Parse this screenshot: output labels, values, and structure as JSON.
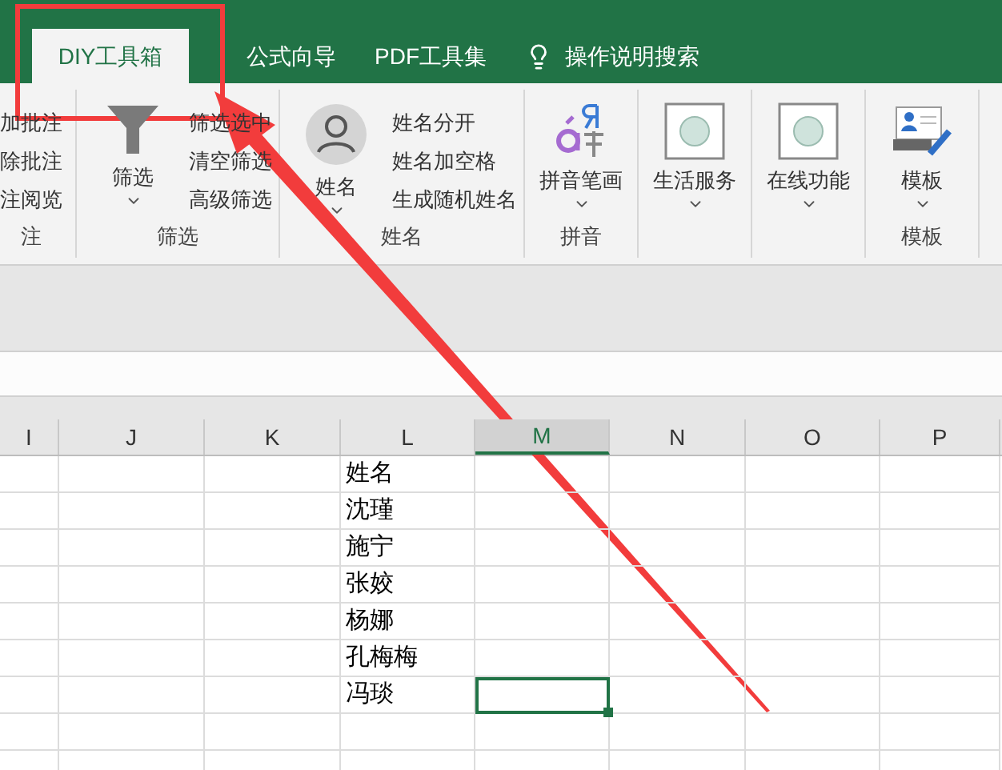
{
  "tabs": [
    {
      "label": "DIY工具箱",
      "selected": true
    },
    {
      "label": "公式向导",
      "selected": false
    },
    {
      "label": "PDF工具集",
      "selected": false
    }
  ],
  "search": {
    "label": "操作说明搜索"
  },
  "ribbon": {
    "groups": [
      {
        "kind": "comments",
        "items": [
          "加批注",
          "除批注",
          "注阅览"
        ],
        "label": "注"
      },
      {
        "kind": "filter",
        "big_label": "筛选",
        "items": [
          "筛选选中",
          "清空筛选",
          "高级筛选"
        ],
        "label": "筛选"
      },
      {
        "kind": "name",
        "big_label": "姓名",
        "items": [
          "姓名分开",
          "姓名加空格",
          "生成随机姓名"
        ],
        "label": "姓名"
      },
      {
        "kind": "pinyin",
        "big_label": "拼音笔画",
        "label": "拼音"
      },
      {
        "kind": "service",
        "big_label": "生活服务"
      },
      {
        "kind": "online",
        "big_label": "在线功能"
      },
      {
        "kind": "template",
        "big_label": "模板",
        "label": "模板"
      }
    ]
  },
  "sheet": {
    "columns": [
      {
        "label": "I",
        "selected": false
      },
      {
        "label": "J",
        "selected": false
      },
      {
        "label": "K",
        "selected": false
      },
      {
        "label": "L",
        "selected": false
      },
      {
        "label": "M",
        "selected": true
      },
      {
        "label": "N",
        "selected": false
      },
      {
        "label": "O",
        "selected": false
      },
      {
        "label": "P",
        "selected": false
      }
    ],
    "rows": [
      {
        "name": "姓名",
        "m_selected": false
      },
      {
        "name": "沈瑾",
        "m_selected": false
      },
      {
        "name": "施宁",
        "m_selected": false
      },
      {
        "name": "张姣",
        "m_selected": false
      },
      {
        "name": "杨娜",
        "m_selected": false
      },
      {
        "name": "孔梅梅",
        "m_selected": false
      },
      {
        "name": "冯琰",
        "m_selected": true
      }
    ]
  }
}
